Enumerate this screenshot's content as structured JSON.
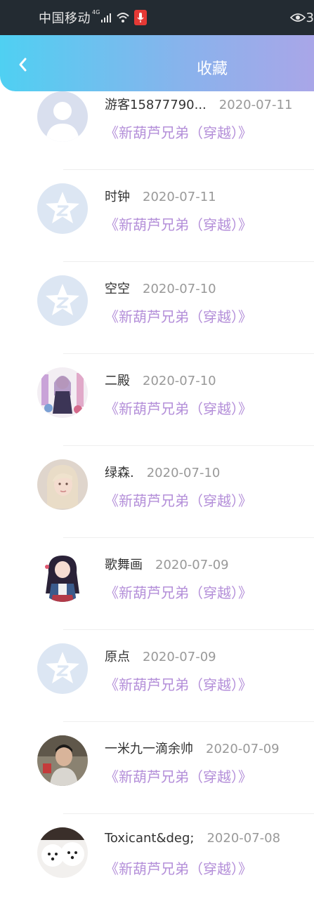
{
  "status_bar": {
    "carrier": "中国移动",
    "network": "4G",
    "right_text": "3"
  },
  "header": {
    "title": "收藏"
  },
  "colors": {
    "status_bg": "#232b32",
    "header_gradient_start": "#4fd0f2",
    "header_gradient_end": "#a9a6e8",
    "book_title": "#b48fd9",
    "username": "#333333",
    "date": "#999999"
  },
  "favorites": [
    {
      "username": "游客15877790...",
      "date": "2020-07-11",
      "book": "《新葫芦兄弟（穿越）》",
      "avatar": "default-person-avatar"
    },
    {
      "username": "时钟",
      "date": "2020-07-11",
      "book": "《新葫芦兄弟（穿越）》",
      "avatar": "qq-star-avatar"
    },
    {
      "username": "空空",
      "date": "2020-07-10",
      "book": "《新葫芦兄弟（穿越）》",
      "avatar": "qq-star-avatar"
    },
    {
      "username": "二殿",
      "date": "2020-07-10",
      "book": "《新葫芦兄弟（穿越）》",
      "avatar": "anime-photo-avatar"
    },
    {
      "username": "绿森.",
      "date": "2020-07-10",
      "book": "《新葫芦兄弟（穿越）》",
      "avatar": "portrait-photo-avatar"
    },
    {
      "username": "歌舞画",
      "date": "2020-07-09",
      "book": "《新葫芦兄弟（穿越）》",
      "avatar": "anime-girl-avatar"
    },
    {
      "username": "原点",
      "date": "2020-07-09",
      "book": "《新葫芦兄弟（穿越）》",
      "avatar": "qq-star-avatar"
    },
    {
      "username": "一米九一滴余帅",
      "date": "2020-07-09",
      "book": "《新葫芦兄弟（穿越）》",
      "avatar": "person-photo-avatar"
    },
    {
      "username": "Toxicant&deg;",
      "date": "2020-07-08",
      "book": "《新葫芦兄弟（穿越）》",
      "avatar": "dog-photo-avatar"
    }
  ]
}
